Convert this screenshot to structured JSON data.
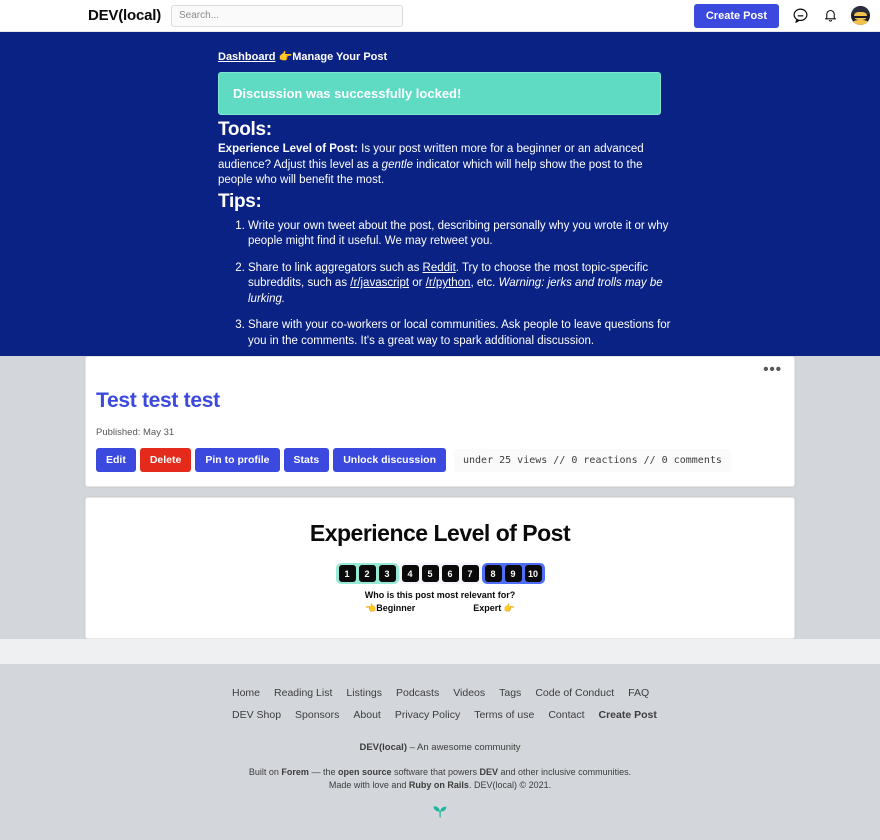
{
  "header": {
    "brand": "DEV(local)",
    "search_placeholder": "Search...",
    "search_value": "",
    "create_post_label": "Create Post",
    "icons": [
      "comment-icon",
      "bell-icon",
      "avatar"
    ]
  },
  "breadcrumb": {
    "dashboard_label": "Dashboard",
    "separator_emoji": "👉",
    "current": "Manage Your Post"
  },
  "flash": {
    "message": "Discussion was successfully locked!",
    "color": "#5fdbc4"
  },
  "tools": {
    "heading": "Tools:",
    "experience_label": "Experience Level of Post:",
    "experience_text_1": " Is your post written more for a beginner or an advanced audience? Adjust this level as a ",
    "experience_emphasis": "gentle",
    "experience_text_2": " indicator which will help show the post to the people who will benefit the most."
  },
  "tips": {
    "heading": "Tips:",
    "items": [
      {
        "parts": [
          {
            "t": "Write your own tweet about the post, describing personally why you wrote it or why people might find it useful. We may retweet you.",
            "style": "normal"
          }
        ]
      },
      {
        "parts": [
          {
            "t": "Share to link aggregators such as ",
            "style": "normal"
          },
          {
            "t": "Reddit",
            "style": "link"
          },
          {
            "t": ". Try to choose the most topic-specific subreddits, such as ",
            "style": "normal"
          },
          {
            "t": "/r/javascript",
            "style": "link"
          },
          {
            "t": " or ",
            "style": "normal"
          },
          {
            "t": "/r/python",
            "style": "link"
          },
          {
            "t": ", etc. ",
            "style": "normal"
          },
          {
            "t": "Warning: jerks and trolls may be lurking.",
            "style": "italic"
          }
        ]
      },
      {
        "parts": [
          {
            "t": "Share with your co-workers or local communities. Ask people to leave questions for you in the comments. It's a great way to spark additional discussion.",
            "style": "normal"
          }
        ]
      }
    ]
  },
  "post": {
    "menu_icon": "•••",
    "title": "Test test test",
    "published": "Published: May 31",
    "buttons": [
      {
        "label": "Edit",
        "kind": "primary",
        "name": "edit-button"
      },
      {
        "label": "Delete",
        "kind": "danger",
        "name": "delete-button"
      },
      {
        "label": "Pin to profile",
        "kind": "primary",
        "name": "pin-to-profile-button"
      },
      {
        "label": "Stats",
        "kind": "primary",
        "name": "stats-button"
      },
      {
        "label": "Unlock discussion",
        "kind": "primary",
        "name": "unlock-discussion-button"
      }
    ],
    "stats": "under 25 views // 0 reactions // 0 comments"
  },
  "experience": {
    "title": "Experience Level of Post",
    "question": "Who is this post most relevant for?",
    "beginner_label": "👈Beginner",
    "expert_label": "Expert 👉",
    "groups": [
      {
        "name": "beginner-range",
        "color": "#97ead6",
        "levels": [
          "1",
          "2",
          "3"
        ]
      },
      {
        "name": "middle-range",
        "color": "#f4f4fb",
        "levels": [
          "4",
          "5",
          "6",
          "7"
        ]
      },
      {
        "name": "expert-range",
        "color": "#4f6ef7",
        "levels": [
          "8",
          "9",
          "10"
        ]
      }
    ]
  },
  "footer": {
    "nav_row_1": [
      {
        "label": "Home",
        "strong": false
      },
      {
        "label": "Reading List",
        "strong": false
      },
      {
        "label": "Listings",
        "strong": false
      },
      {
        "label": "Podcasts",
        "strong": false
      },
      {
        "label": "Videos",
        "strong": false
      },
      {
        "label": "Tags",
        "strong": false
      },
      {
        "label": "Code of Conduct",
        "strong": false
      },
      {
        "label": "FAQ",
        "strong": false
      }
    ],
    "nav_row_2": [
      {
        "label": "DEV Shop",
        "strong": false
      },
      {
        "label": "Sponsors",
        "strong": false
      },
      {
        "label": "About",
        "strong": false
      },
      {
        "label": "Privacy Policy",
        "strong": false
      },
      {
        "label": "Terms of use",
        "strong": false
      },
      {
        "label": "Contact",
        "strong": false
      },
      {
        "label": "Create Post",
        "strong": true
      }
    ],
    "tagline_brand": "DEV(local)",
    "tagline_rest": " – An awesome community",
    "built_line_1_a": "Built on ",
    "built_line_1_forem": "Forem",
    "built_line_1_b": " — the ",
    "built_line_1_os": "open source",
    "built_line_1_c": " software that powers ",
    "built_line_1_dev": "DEV",
    "built_line_1_d": " and other inclusive communities.",
    "built_line_2_a": "Made with love and ",
    "built_line_2_rails": "Ruby on Rails",
    "built_line_2_b": ". DEV(local) © 2021.",
    "sprout_icon": "seedling-icon"
  }
}
